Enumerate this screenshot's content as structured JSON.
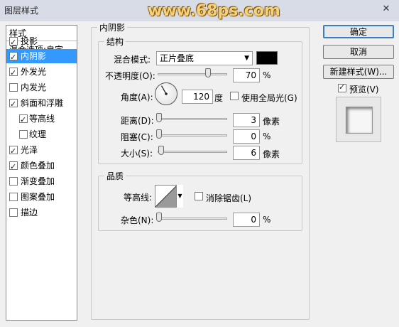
{
  "window": {
    "title": "图层样式",
    "close": "✕"
  },
  "watermark": "www.68ps.com",
  "styles_list": {
    "header": "样式",
    "blend_options": "混合选项:自定",
    "items": [
      {
        "label": "投影",
        "checked": true,
        "selected": false
      },
      {
        "label": "内阴影",
        "checked": true,
        "selected": true
      },
      {
        "label": "外发光",
        "checked": true,
        "selected": false
      },
      {
        "label": "内发光",
        "checked": false,
        "selected": false
      },
      {
        "label": "斜面和浮雕",
        "checked": true,
        "selected": false
      },
      {
        "label": "等高线",
        "checked": true,
        "selected": false
      },
      {
        "label": "纹理",
        "checked": false,
        "selected": false
      },
      {
        "label": "光泽",
        "checked": true,
        "selected": false
      },
      {
        "label": "颜色叠加",
        "checked": true,
        "selected": false
      },
      {
        "label": "渐变叠加",
        "checked": false,
        "selected": false
      },
      {
        "label": "图案叠加",
        "checked": false,
        "selected": false
      },
      {
        "label": "描边",
        "checked": false,
        "selected": false
      }
    ]
  },
  "panel": {
    "title": "内阴影",
    "structure": {
      "legend": "结构",
      "blend_mode_label": "混合模式:",
      "blend_mode_value": "正片叠底",
      "blend_color": "#000000",
      "opacity_label": "不透明度(O):",
      "opacity_value": "70",
      "opacity_fraction": 0.7,
      "percent": "%",
      "angle_label": "角度(A):",
      "angle_value": "120",
      "angle_unit": "度",
      "global_light_label": "使用全局光(G)",
      "global_light_checked": false,
      "distance_label": "距离(D):",
      "distance_value": "3",
      "distance_fraction": 0.0,
      "choke_label": "阻塞(C):",
      "choke_value": "0",
      "choke_fraction": 0.0,
      "size_label": "大小(S):",
      "size_value": "6",
      "size_fraction": 0.03,
      "pixels_unit": "像素"
    },
    "quality": {
      "legend": "品质",
      "contour_label": "等高线:",
      "anti_alias_label": "消除锯齿(L)",
      "anti_alias_checked": false,
      "noise_label": "杂色(N):",
      "noise_value": "0",
      "noise_fraction": 0.0
    }
  },
  "buttons": {
    "ok": "确定",
    "cancel": "取消",
    "new_style": "新建样式(W)...",
    "preview_label": "预览(V)",
    "preview_checked": true
  }
}
